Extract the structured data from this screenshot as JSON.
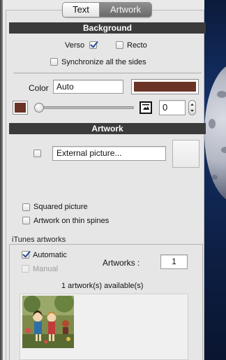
{
  "tabs": [
    {
      "label": "Text",
      "selected": false
    },
    {
      "label": "Artwork",
      "selected": true
    }
  ],
  "background": {
    "title": "Background",
    "verso": {
      "label": "Verso",
      "checked": true
    },
    "recto": {
      "label": "Recto",
      "checked": false
    },
    "synchronize": {
      "label": "Synchronize all the sides",
      "checked": false
    },
    "color_label": "Color",
    "color_value": "Auto",
    "color_swatch": "#6b3326",
    "small_swatch": "#6b3326",
    "slider_value": 0,
    "number_value": "0",
    "icon_name": "picture-frame-icon"
  },
  "artwork": {
    "title": "Artwork",
    "external_checked": false,
    "external_label": "External picture...",
    "squared": {
      "label": "Squared picture",
      "checked": false
    },
    "thin_spines": {
      "label": "Artwork on thin spines",
      "checked": false
    }
  },
  "itunes": {
    "title": "iTunes artworks",
    "automatic": {
      "label": "Automatic",
      "checked": true
    },
    "manual": {
      "label": "Manual",
      "checked": false,
      "disabled": true
    },
    "artworks_label": "Artworks :",
    "artworks_value": "1",
    "available_text": "1 artwork(s) available(s)"
  },
  "colors": {
    "section_bar": "#3b3b3b",
    "check_accent": "#2a4d96"
  }
}
